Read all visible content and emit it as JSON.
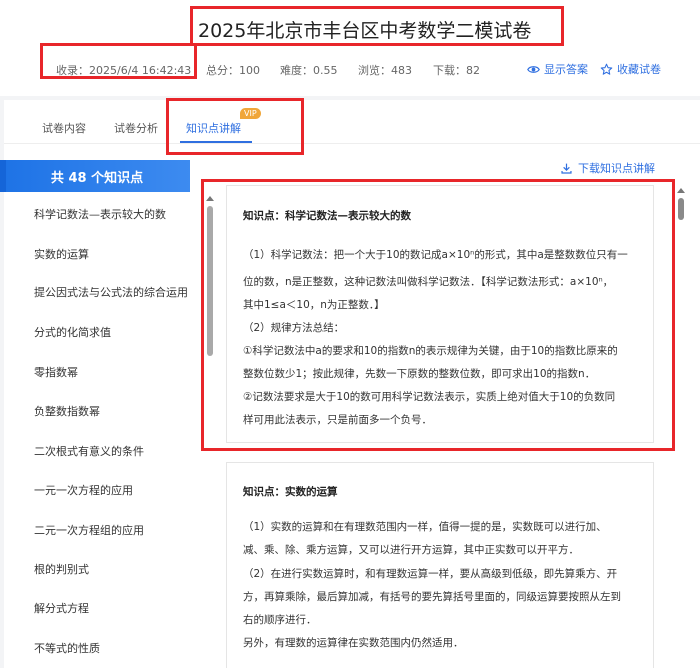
{
  "header": {
    "title": "2025年北京市丰台区中考数学二模试卷",
    "collected": "收录：2025/6/4 16:42:43",
    "score": "总分：100",
    "difficulty": "难度：0.55",
    "views": "浏览：483",
    "downloads": "下载：82",
    "show_answer": "显示答案",
    "favorite": "收藏试卷"
  },
  "tabs": {
    "content": "试卷内容",
    "analysis": "试卷分析",
    "knowledge": "知识点讲解",
    "vip": "VIP"
  },
  "sidebar": {
    "heading": "共 48 个知识点",
    "items": [
      "科学记数法—表示较大的数",
      "实数的运算",
      "提公因式法与公式法的综合运用",
      "分式的化简求值",
      "零指数幂",
      "负整数指数幂",
      "二次根式有意义的条件",
      "一元一次方程的应用",
      "二元一次方程组的应用",
      "根的判别式",
      "解分式方程",
      "不等式的性质"
    ]
  },
  "download_label": "下载知识点讲解",
  "cards": [
    {
      "title": "知识点：科学记数法—表示较大的数",
      "lines": [
        "（1）科学记数法：把一个大于10的数记成a×10ⁿ的形式，其中a是整数数位只有一",
        "位的数，n是正整数，这种记数法叫做科学记数法．【科学记数法形式：a×10ⁿ，",
        "其中1≤a＜10，n为正整数．】",
        "（2）规律方法总结：",
        "①科学记数法中a的要求和10的指数n的表示规律为关键，由于10的指数比原来的",
        "整数位数少1；按此规律，先数一下原数的整数位数，即可求出10的指数n．",
        "②记数法要求是大于10的数可用科学记数法表示，实质上绝对值大于10的负数同",
        "样可用此法表示，只是前面多一个负号．"
      ]
    },
    {
      "title": "知识点：实数的运算",
      "lines": [
        "（1）实数的运算和在有理数范围内一样，值得一提的是，实数既可以进行加、",
        "减、乘、除、乘方运算，又可以进行开方运算，其中正实数可以开平方．",
        "（2）在进行实数运算时，和有理数运算一样，要从高级到低级，即先算乘方、开",
        "方，再算乘除，最后算加减，有括号的要先算括号里面的，同级运算要按照从左到",
        "右的顺序进行．",
        "另外，有理数的运算律在实数范围内仍然适用．"
      ]
    }
  ],
  "colors": {
    "accent": "#2f6fe0",
    "highlight": "#e8262a",
    "vip": "#f0a63a"
  }
}
